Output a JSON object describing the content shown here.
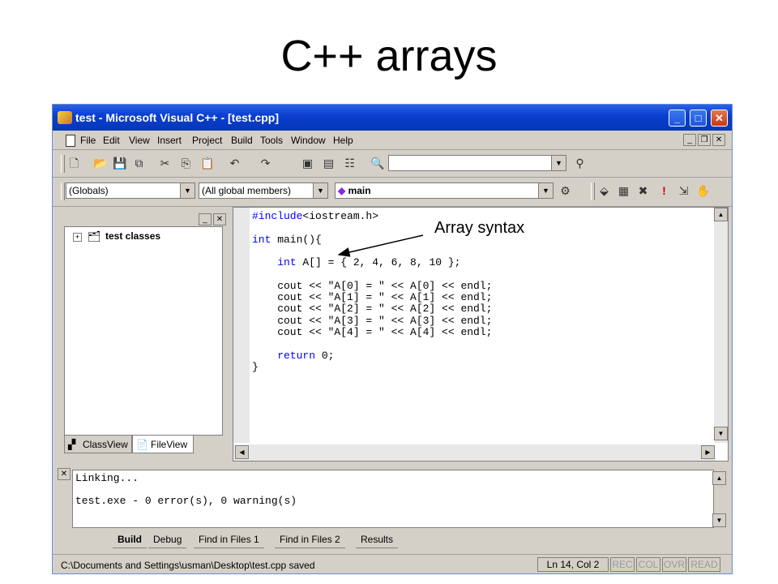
{
  "slide": {
    "title": "C++ arrays"
  },
  "window": {
    "title": "test - Microsoft Visual C++ - [test.cpp]"
  },
  "menu": [
    "File",
    "Edit",
    "View",
    "Insert",
    "Project",
    "Build",
    "Tools",
    "Window",
    "Help"
  ],
  "toolbar2": {
    "globals": "(Globals)",
    "members": "(All global members)",
    "function": "main"
  },
  "workspace": {
    "tree_root": "test classes",
    "tabs": [
      "ClassView",
      "FileView"
    ]
  },
  "editor": {
    "code_lines": [
      "#include<iostream.h>",
      "",
      "int main(){",
      "",
      "    int A[] = { 2, 4, 6, 8, 10 };",
      "",
      "    cout << \"A[0] = \" << A[0] << endl;",
      "    cout << \"A[1] = \" << A[1] << endl;",
      "    cout << \"A[2] = \" << A[2] << endl;",
      "    cout << \"A[3] = \" << A[3] << endl;",
      "    cout << \"A[4] = \" << A[4] << endl;",
      "",
      "    return 0;",
      "}"
    ]
  },
  "annotation": {
    "label": "Array syntax"
  },
  "output": {
    "lines": [
      "Linking...",
      "",
      "test.exe - 0 error(s), 0 warning(s)"
    ],
    "tabs": [
      "Build",
      "Debug",
      "Find in Files 1",
      "Find in Files 2",
      "Results"
    ]
  },
  "status": {
    "text": "C:\\Documents and Settings\\usman\\Desktop\\test.cpp saved",
    "position": "Ln 14, Col 2",
    "indicators": [
      "REC",
      "COL",
      "OVR",
      "READ"
    ]
  },
  "colors": {
    "titlebar": "#0a3fd0",
    "chrome": "#d4d0c8",
    "keyword": "#0000ff"
  }
}
